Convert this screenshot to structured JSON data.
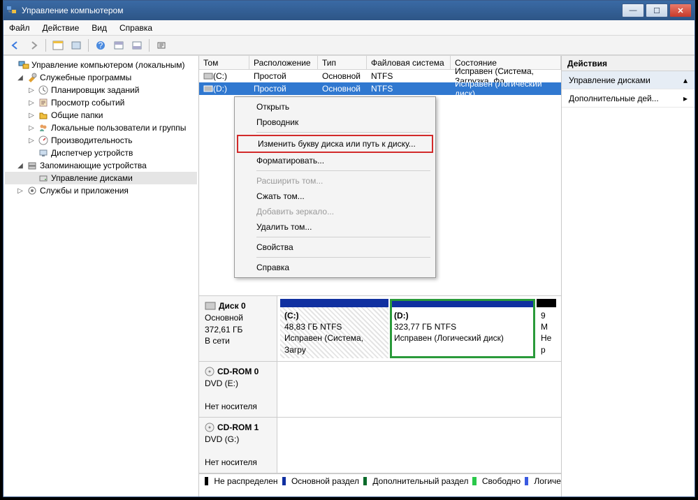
{
  "window": {
    "title": "Управление компьютером"
  },
  "menu": {
    "file": "Файл",
    "action": "Действие",
    "view": "Вид",
    "help": "Справка"
  },
  "tree": {
    "root": "Управление компьютером (локальным)",
    "sys_tools": "Служебные программы",
    "scheduler": "Планировщик заданий",
    "events": "Просмотр событий",
    "shared": "Общие папки",
    "users": "Локальные пользователи и группы",
    "perf": "Производительность",
    "devmgr": "Диспетчер устройств",
    "storage": "Запоминающие устройства",
    "diskmgmt": "Управление дисками",
    "services": "Службы и приложения"
  },
  "cols": {
    "vol": "Том",
    "layout": "Расположение",
    "type": "Тип",
    "fs": "Файловая система",
    "status": "Состояние"
  },
  "volumes": [
    {
      "name": "(C:)",
      "layout": "Простой",
      "type": "Основной",
      "fs": "NTFS",
      "status": "Исправен (Система, Загрузка, Фа"
    },
    {
      "name": "(D:)",
      "layout": "Простой",
      "type": "Основной",
      "fs": "NTFS",
      "status": "Исправен (Логический диск)"
    }
  ],
  "disks": {
    "d0": {
      "title": "Диск 0",
      "type": "Основной",
      "size": "372,61 ГБ",
      "state": "В сети"
    },
    "cd0": {
      "title": "CD-ROM 0",
      "type": "DVD (E:)",
      "state": "Нет носителя"
    },
    "cd1": {
      "title": "CD-ROM 1",
      "type": "DVD (G:)",
      "state": "Нет носителя"
    }
  },
  "parts": {
    "c": {
      "name": "(C:)",
      "info": "48,83 ГБ NTFS",
      "status": "Исправен (Система, Загру"
    },
    "d": {
      "name": "(D:)",
      "info": "323,77 ГБ NTFS",
      "status": "Исправен (Логический диск)"
    },
    "u": {
      "l1": "9 М",
      "l2": "Не р"
    }
  },
  "legend": {
    "unalloc": "Не распределен",
    "primary": "Основной раздел",
    "ext": "Дополнительный раздел",
    "free": "Свободно",
    "logical": "Логиче"
  },
  "ctx": {
    "open": "Открыть",
    "explorer": "Проводник",
    "change_letter": "Изменить букву диска или путь к диску...",
    "format": "Форматировать...",
    "extend": "Расширить том...",
    "shrink": "Сжать том...",
    "mirror": "Добавить зеркало...",
    "delete": "Удалить том...",
    "props": "Свойства",
    "help": "Справка"
  },
  "actions": {
    "header": "Действия",
    "group": "Управление дисками",
    "more": "Дополнительные дей..."
  }
}
